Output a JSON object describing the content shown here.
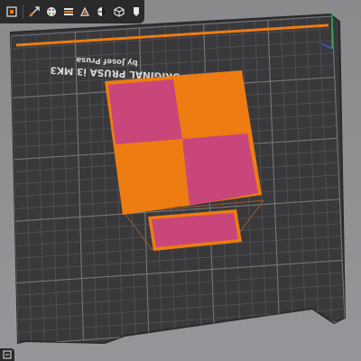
{
  "bed": {
    "line1": "ORIGINAL PRUSA i3 MK3",
    "line2": "by Josef Prusa"
  },
  "toolbar": {
    "tools": [
      {
        "name": "add-tool",
        "icon": "add-icon"
      },
      {
        "name": "arrange-tool",
        "icon": "arrange-icon"
      },
      {
        "name": "paint-tool",
        "icon": "paint-color-icon"
      },
      {
        "name": "variable-layer-tool",
        "icon": "layer-height-icon"
      },
      {
        "name": "seam-tool",
        "icon": "seam-icon"
      },
      {
        "name": "support-tool",
        "icon": "support-paint-icon"
      },
      {
        "name": "view-tool",
        "icon": "cube-view-icon"
      },
      {
        "name": "cut-tool",
        "icon": "split-icon"
      }
    ]
  },
  "colors": {
    "background": "#8e8e90",
    "bed": "#3a3a3c",
    "grid": "#5c5c60",
    "orange": "#ed7c12",
    "magenta": "#c8467a",
    "toolbar": "#2a2a2c"
  }
}
